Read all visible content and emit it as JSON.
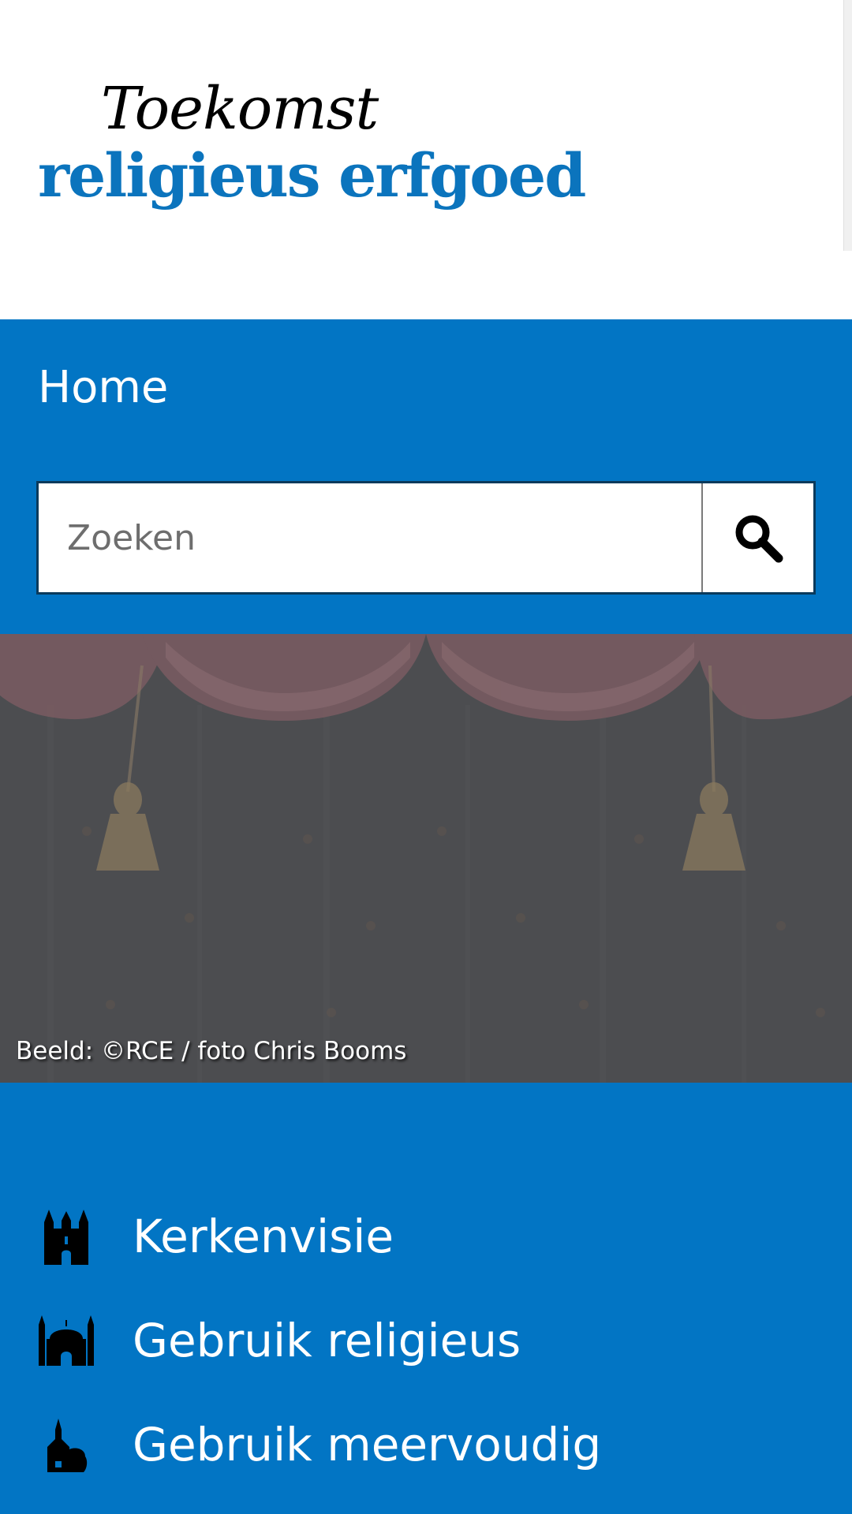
{
  "brand": {
    "line1": "Toekomst",
    "line2": "religieus erfgoed",
    "accent_color": "#0275c4"
  },
  "nav": {
    "home_label": "Home"
  },
  "search": {
    "placeholder": "Zoeken",
    "button_icon": "search-icon"
  },
  "hero": {
    "caption": "Beeld: ©RCE / foto Chris Booms"
  },
  "topics": [
    {
      "label": "Kerkenvisie",
      "icon": "church-icon"
    },
    {
      "label": "Gebruik religieus",
      "icon": "mosque-icon"
    },
    {
      "label": "Gebruik meervoudig",
      "icon": "chapel-tree-icon"
    }
  ]
}
